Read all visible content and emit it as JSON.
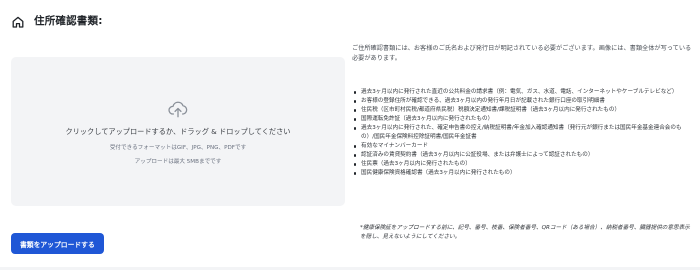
{
  "header": {
    "icon": "home-icon",
    "title": "住所確認書類:"
  },
  "dropzone": {
    "icon": "cloud-upload-icon",
    "main_text": "クリックしてアップロードするか、ドラッグ & ドロップしてください",
    "formats_text": "受付できるフォーマットはGIF、JPG、PNG、PDFです",
    "max_size_text": "アップロードは最大 5MBまでです"
  },
  "description": "ご住所確認書類には、お客様のご氏名および発行日が明記されている必要がございます。画像には、書類全体が写っている必要があります。",
  "documents": [
    "過去3ヶ月以内に発行された直近の公共料金の請求書（例：電気、ガス、水道、電話、インターネットやケーブルテレビなど）",
    "お客様の登録住所が確認できる、過去3ヶ月以内の発行年月日が記載された銀行口座の取引明細書",
    "住民税（区市町村民税/都道府県民税）税額決定通知書/課税証明書（過去3ヶ月以内に発行されたもの）",
    "国際運転免許証（過去3ヶ月以内に発行されたもの）",
    "過去3ヶ月以内に発行された、確定申告書の控え/納税証明書/年金加入確認通知書（発行元が銀行または国民年金基金連合会のもの）/国民年金保険料控除証明書/国民年金証書",
    "有効なマイナンバーカード",
    "認証済みの賃貸契約書（過去3ヶ月以内に公証役場、または弁護士によって認証されたもの）",
    "住民票（過去3ヶ月以内に発行されたもの）",
    "国民健康保険資格確認書（過去3ヶ月以内に発行されたもの）"
  ],
  "note": "*健康保険証をアップロードする前に、記号、番号、枝番、保険者番号、QRコード（ある場合）、納税者番号、臓器提供の意思表示を隠し、見えないようにしてください。",
  "upload_button": {
    "label": "書類をアップロードする"
  },
  "colors": {
    "accent": "#1f57d6",
    "dropzone_bg": "#f3f4f6"
  }
}
